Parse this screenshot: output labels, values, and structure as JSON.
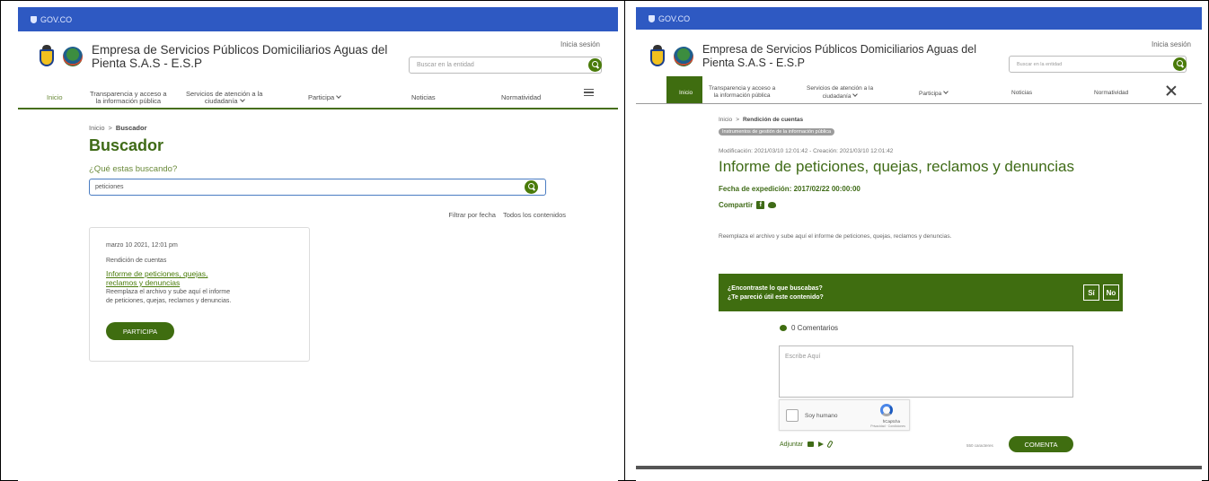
{
  "left": {
    "gov_label": "GOV.CO",
    "entity_line1": "Empresa de Servicios Públicos Domiciliarios Aguas del",
    "entity_line2": "Pienta S.A.S - E.S.P",
    "login": "Inicia sesión",
    "search_placeholder": "Buscar en la entidad",
    "nav": {
      "inicio": "Inicio",
      "transparencia_1": "Transparencia y acceso a",
      "transparencia_2": "la información pública",
      "servicios_1": "Servicios de atención a la",
      "servicios_2": "ciudadanía",
      "participa": "Participa",
      "noticias": "Noticias",
      "normatividad": "Normatividad"
    },
    "breadcrumb_home": "Inicio",
    "breadcrumb_current": "Buscador",
    "title": "Buscador",
    "question": "¿Qué estas buscando?",
    "search_value": "peticiones",
    "filter_date": "Filtrar por fecha",
    "filter_content": "Todos los contenidos",
    "result": {
      "date": "marzo 10 2021, 12:01 pm",
      "category": "Rendición de cuentas",
      "link_1": "Informe de peticiones, quejas,",
      "link_2": "reclamos y denuncias",
      "desc_1": "Reemplaza el archivo y sube aquí el informe",
      "desc_2": "de peticiones, quejas, reclamos y denuncias.",
      "button": "PARTICIPA"
    }
  },
  "right": {
    "gov_label": "GOV.CO",
    "entity_line1": "Empresa de Servicios Públicos Domiciliarios Aguas del",
    "entity_line2": "Pienta S.A.S - E.S.P",
    "login": "Inicia sesión",
    "search_placeholder": "Buscar en la entidad",
    "nav": {
      "inicio": "Inicio",
      "transparencia_1": "Transparencia y acceso a",
      "transparencia_2": "la información pública",
      "servicios_1": "Servicios de atención a la",
      "servicios_2": "ciudadanía",
      "participa": "Participa",
      "noticias": "Noticias",
      "normatividad": "Normatividad"
    },
    "breadcrumb_home": "Inicio",
    "breadcrumb_current": "Rendición de cuentas",
    "tag": "Instrumentos de gestión de la información pública",
    "meta": "Modificación: 2021/03/10 12:01:42 - Creación: 2021/03/10 12:01:42",
    "title": "Informe de peticiones, quejas, reclamos y denuncias",
    "fecha": "Fecha de expedición: 2017/02/22 00:00:00",
    "share": "Compartir",
    "body": "Reemplaza el archivo y sube aquí el informe de peticiones, quejas, reclamos y denuncias.",
    "feedback_1": "¿Encontraste lo que buscabas?",
    "feedback_2": "¿Te pareció útil este contenido?",
    "yes": "Sí",
    "no": "No",
    "comments_count": "0 Comentarios",
    "textarea_placeholder": "Escribe Aquí",
    "captcha_label": "Soy humano",
    "captcha_brand": "hCaptcha",
    "captcha_terms": "Privacidad · Condiciones",
    "attach": "Adjuntar",
    "chars": "550 caracteres",
    "comment_button": "COMENTA"
  },
  "colors": {
    "gov_blue": "#2e59c2",
    "brand_green": "#3f6d10",
    "title_green": "#3f6b17"
  }
}
